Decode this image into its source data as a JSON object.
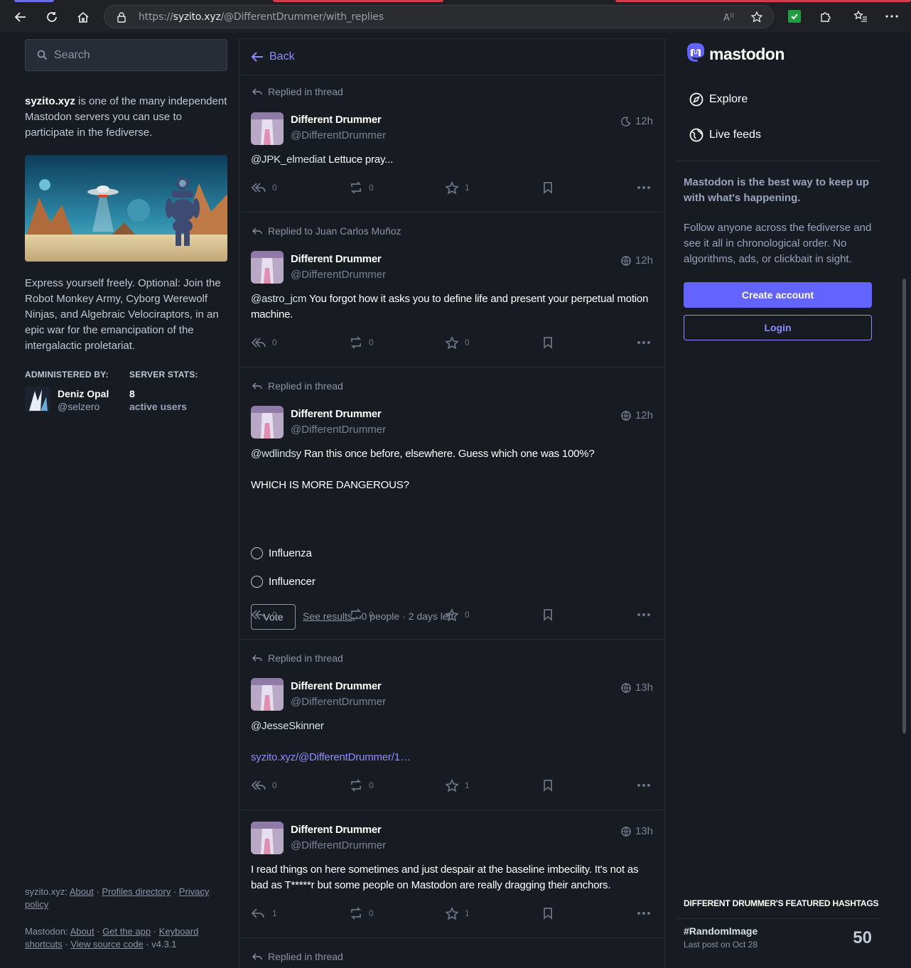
{
  "browser": {
    "url_prefix": "https://",
    "url_host": "syzito.xyz",
    "url_path": "/@DifferentDrummer/with_replies"
  },
  "sidebar": {
    "search_placeholder": "Search",
    "server_name": "syzito.xyz",
    "server_intro": " is one of the many independent Mastodon servers you can use to participate in the fediverse.",
    "about_text": "Express yourself freely. Optional: Join the Robot Monkey Army, Cyborg Werewolf Ninjas, and Algebraic Velociraptors, in an epic war for the emancipation of the intergalactic proletariat.",
    "admin_label": "ADMINISTERED BY:",
    "stats_label": "SERVER STATS:",
    "admin_name": "Deniz Opal",
    "admin_handle": "@selzero",
    "stats_value": "8",
    "stats_unit": "active users",
    "footer1_prefix": "syzito.xyz:",
    "footer1_about": "About",
    "footer1_directory": "Profiles directory",
    "footer1_privacy": "Privacy policy",
    "footer2_prefix": "Mastodon:",
    "footer2_about": "About",
    "footer2_app": "Get the app",
    "footer2_shortcuts": "Keyboard shortcuts",
    "footer2_source": "View source code",
    "footer2_version": "v4.3.1"
  },
  "column": {
    "back_label": "Back"
  },
  "posts": [
    {
      "prepend": "Replied in thread",
      "display_name": "Different Drummer",
      "handle": "@DifferentDrummer",
      "time": "12h",
      "mention": "@JPK_elmediat",
      "text": " Lettuce pray...",
      "replies": "0",
      "boosts": "0",
      "favs": "1"
    },
    {
      "prepend": "Replied to Juan Carlos Muñoz",
      "display_name": "Different Drummer",
      "handle": "@DifferentDrummer",
      "time": "12h",
      "mention": "@astro_jcm",
      "text": " You forgot  how it asks you to define life and present your perpetual motion machine.",
      "replies": "0",
      "boosts": "0",
      "favs": "0"
    },
    {
      "prepend": "Replied in thread",
      "display_name": "Different Drummer",
      "handle": "@DifferentDrummer",
      "time": "12h",
      "mention": "@wdlindsy",
      "text": " Ran this once before, elsewhere. Guess which one was 100%?",
      "text2": "WHICH IS MORE DANGEROUS?",
      "poll_options": [
        "Influenza",
        "Influencer"
      ],
      "vote_label": "Vote",
      "see_results": "See results",
      "poll_meta": " · 0 people · 2 days left",
      "replies": "0",
      "boosts": "0",
      "favs": "0"
    },
    {
      "prepend": "Replied in thread",
      "display_name": "Different Drummer",
      "handle": "@DifferentDrummer",
      "time": "13h",
      "mention": "@JesseSkinner",
      "link": "syzito.xyz/@DifferentDrummer/1…",
      "replies": "0",
      "boosts": "0",
      "favs": "1"
    },
    {
      "display_name": "Different Drummer",
      "handle": "@DifferentDrummer",
      "time": "13h",
      "text": "I read things on here sometimes and just despair at the baseline imbecility.  It's not as bad as T*****r but some people on Mastodon are really dragging their anchors.",
      "replies": "1",
      "boosts": "0",
      "favs": "1"
    },
    {
      "prepend": "Replied in thread"
    }
  ],
  "right": {
    "logo_text": "mastodon",
    "nav": [
      "Explore",
      "Live feeds"
    ],
    "cta_title": "Mastodon is the best way to keep up with what's happening.",
    "cta_text": "Follow anyone across the fediverse and see it all in chronological order. No algorithms, ads, or clickbait in sight.",
    "create_account": "Create account",
    "login": "Login",
    "tags_heading": "DIFFERENT DRUMMER'S FEATURED HASHTAGS",
    "tag_name": "#RandomImage",
    "tag_sub": "Last post on Oct 28",
    "tag_count": "50"
  },
  "colors": {
    "background": "#191b22",
    "accent": "#6364ff",
    "link": "#8c8dff",
    "muted": "#8d93a6"
  }
}
